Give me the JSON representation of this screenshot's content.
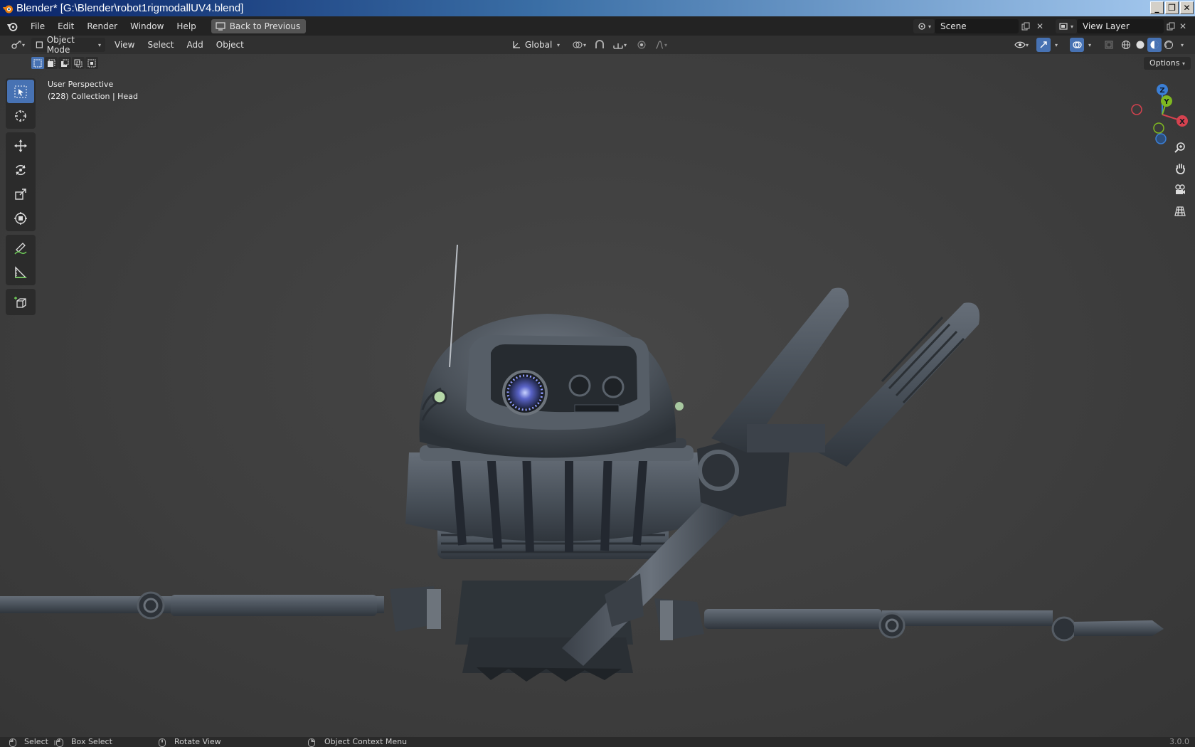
{
  "window": {
    "title": "Blender* [G:\\Blender\\robot1rigmodallUV4.blend]",
    "controls": [
      "minimize",
      "maximize",
      "close"
    ]
  },
  "topbar": {
    "menus": [
      "File",
      "Edit",
      "Render",
      "Window",
      "Help"
    ],
    "back_button": "Back to Previous",
    "scene": "Scene",
    "view_layer": "View Layer"
  },
  "viewport_header": {
    "mode": "Object Mode",
    "menus": [
      "View",
      "Select",
      "Add",
      "Object"
    ],
    "transform_orientation": "Global"
  },
  "viewport": {
    "options_label": "Options",
    "perspective": "User Perspective",
    "collection_info": "(228) Collection | Head",
    "gizmo_axes": [
      "Z",
      "Y",
      "X"
    ],
    "colors": {
      "x": "#d6424f",
      "y": "#7fb821",
      "z": "#3b7fd6",
      "accent": "#4772b3"
    }
  },
  "toolbar": {
    "tools": [
      "select-box",
      "cursor",
      "move",
      "rotate",
      "scale",
      "transform",
      "annotate",
      "measure",
      "add-cube"
    ]
  },
  "statusbar": {
    "select": "Select",
    "box_select": "Box Select",
    "rotate_view": "Rotate View",
    "context_menu": "Object Context Menu",
    "version": "3.0.0"
  }
}
